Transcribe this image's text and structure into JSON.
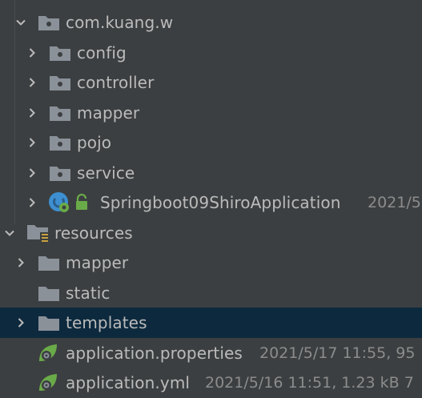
{
  "tree": {
    "package_root": {
      "label": "com.kuang.w"
    },
    "packages": [
      {
        "label": "config"
      },
      {
        "label": "controller"
      },
      {
        "label": "mapper"
      },
      {
        "label": "pojo"
      },
      {
        "label": "service"
      }
    ],
    "app_class": {
      "label": "Springboot09ShiroApplication",
      "meta": "2021/5"
    },
    "resources": {
      "label": "resources"
    },
    "resource_folders": [
      {
        "label": "mapper"
      },
      {
        "label": "static"
      },
      {
        "label": "templates"
      }
    ],
    "files": [
      {
        "label": "application.properties",
        "meta": "2021/5/17 11:55, 95"
      },
      {
        "label": "application.yml",
        "meta": "2021/5/16 11:51, 1.23 kB 7"
      }
    ]
  },
  "colors": {
    "background": "#3c3f41",
    "selection": "#0d293e",
    "folder": "#8a9199",
    "spring_green": "#6aab49",
    "class_blue": "#3d8fd1"
  }
}
